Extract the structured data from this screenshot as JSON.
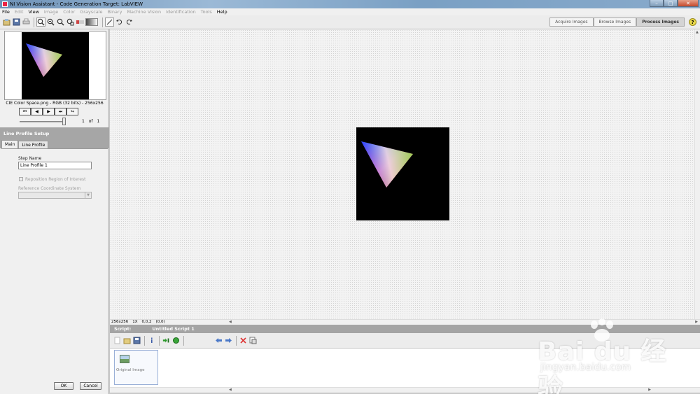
{
  "window": {
    "title": "NI Vision Assistant - Code Generation Target: LabVIEW",
    "min": "–",
    "max": "□",
    "close": "✕"
  },
  "menu": [
    {
      "label": "File",
      "enabled": true
    },
    {
      "label": "Edit",
      "enabled": false
    },
    {
      "label": "View",
      "enabled": true
    },
    {
      "label": "Image",
      "enabled": false
    },
    {
      "label": "Color",
      "enabled": false
    },
    {
      "label": "Grayscale",
      "enabled": false
    },
    {
      "label": "Binary",
      "enabled": false
    },
    {
      "label": "Machine Vision",
      "enabled": false
    },
    {
      "label": "Identification",
      "enabled": false
    },
    {
      "label": "Tools",
      "enabled": false
    },
    {
      "label": "Help",
      "enabled": true
    }
  ],
  "mode_tabs": {
    "acquire": "Acquire Images",
    "browse": "Browse Images",
    "process": "Process Images"
  },
  "help": "?",
  "thumbnail": {
    "caption": "CIE Color Space.png - RGB (32 bits) - 256x256"
  },
  "navigator": {
    "current": "1",
    "of": "of",
    "total": "1"
  },
  "setup": {
    "header": "Line Profile Setup",
    "tabs": {
      "main": "Main",
      "line_profile": "Line Profile"
    },
    "step_name_label": "Step Name",
    "step_name_value": "Line Profile 1",
    "reposition_label": "Reposition Region of Interest",
    "ref_coord_label": "Reference Coordinate System",
    "ok": "OK",
    "cancel": "Cancel"
  },
  "status": {
    "size": "256x256",
    "zoom": "1X",
    "pixel": "0,0,2",
    "coords": "(0,0)"
  },
  "script": {
    "label": "Script:",
    "name": "Untitled Script 1",
    "steps": [
      {
        "label": "Original Image"
      }
    ]
  },
  "watermark": {
    "brand": "Bai du 经验",
    "url": "jingyan.baidu.com"
  },
  "colors": {
    "header_gray": "#a6a6a6",
    "viewer_bg": "#f3f3f3",
    "image_bg": "#000000"
  }
}
